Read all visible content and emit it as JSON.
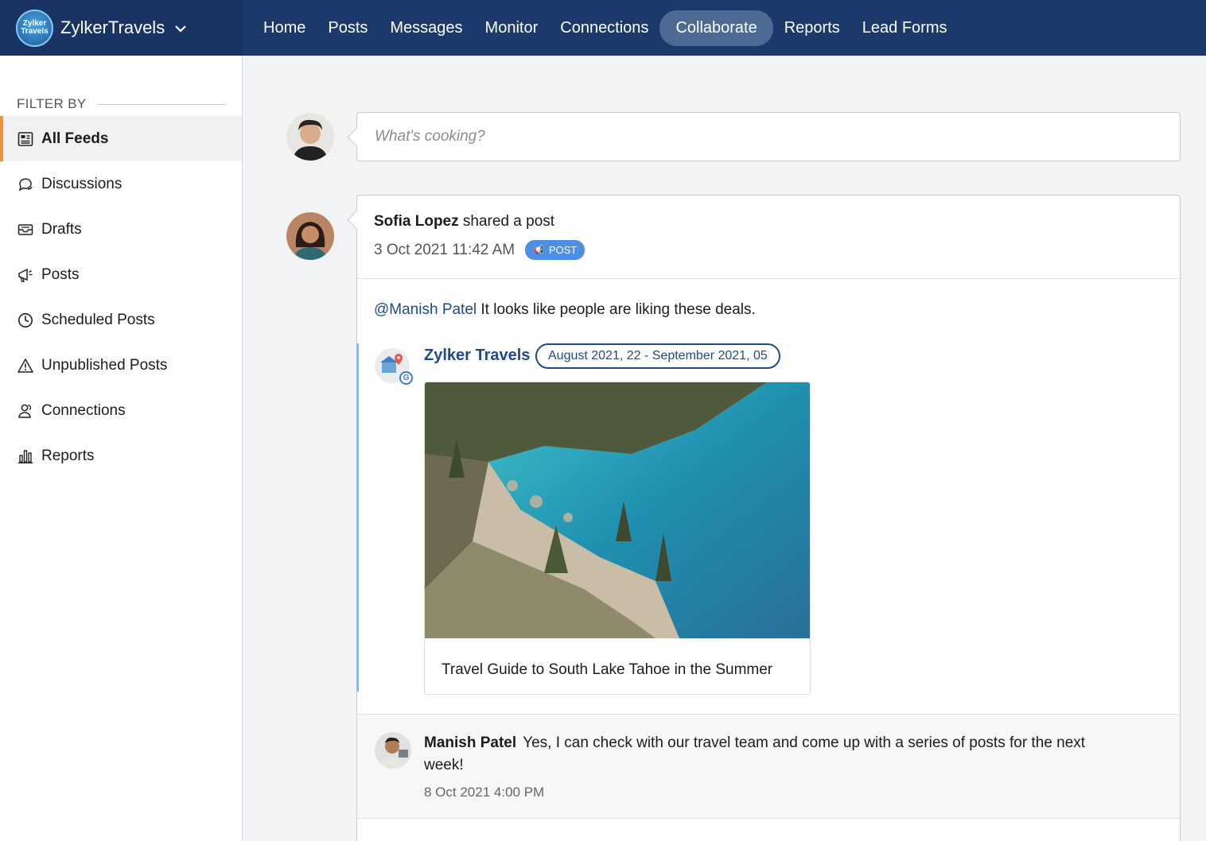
{
  "brand": {
    "name": "ZylkerTravels",
    "logo_line1": "Zylker",
    "logo_line2": "Travels"
  },
  "nav": [
    {
      "label": "Home"
    },
    {
      "label": "Posts"
    },
    {
      "label": "Messages"
    },
    {
      "label": "Monitor"
    },
    {
      "label": "Connections"
    },
    {
      "label": "Collaborate",
      "active": true
    },
    {
      "label": "Reports"
    },
    {
      "label": "Lead Forms"
    }
  ],
  "sidebar": {
    "filter_label": "FILTER BY",
    "items": [
      {
        "label": "All Feeds",
        "icon": "feed-icon",
        "active": true
      },
      {
        "label": "Discussions",
        "icon": "chat-icon"
      },
      {
        "label": "Drafts",
        "icon": "inbox-icon"
      },
      {
        "label": "Posts",
        "icon": "megaphone-icon"
      },
      {
        "label": "Scheduled Posts",
        "icon": "clock-icon"
      },
      {
        "label": "Unpublished Posts",
        "icon": "warning-icon"
      },
      {
        "label": "Connections",
        "icon": "users-icon"
      },
      {
        "label": "Reports",
        "icon": "bar-chart-icon"
      }
    ]
  },
  "composer": {
    "placeholder": "What's cooking?"
  },
  "post": {
    "author": "Sofia Lopez",
    "action": " shared a post",
    "time": "3 Oct 2021 11:42 AM",
    "badge": "POST",
    "mention": "@Manish Patel",
    "message": " It looks like people are liking these deals.",
    "shared": {
      "title": "Zylker Travels",
      "date_range": "August 2021, 22 - September 2021, 05",
      "caption": "Travel Guide to South Lake Tahoe in the Summer"
    }
  },
  "comment": {
    "author": "Manish Patel",
    "text": "Yes, I can check with our travel team and come up with a series of posts for the next week!",
    "time": "8 Oct 2021 4:00 PM"
  },
  "colors": {
    "topbar": "#1b3a6b",
    "accent": "#f3913b",
    "link": "#1e4a8c",
    "badge": "#4e8fe6"
  }
}
